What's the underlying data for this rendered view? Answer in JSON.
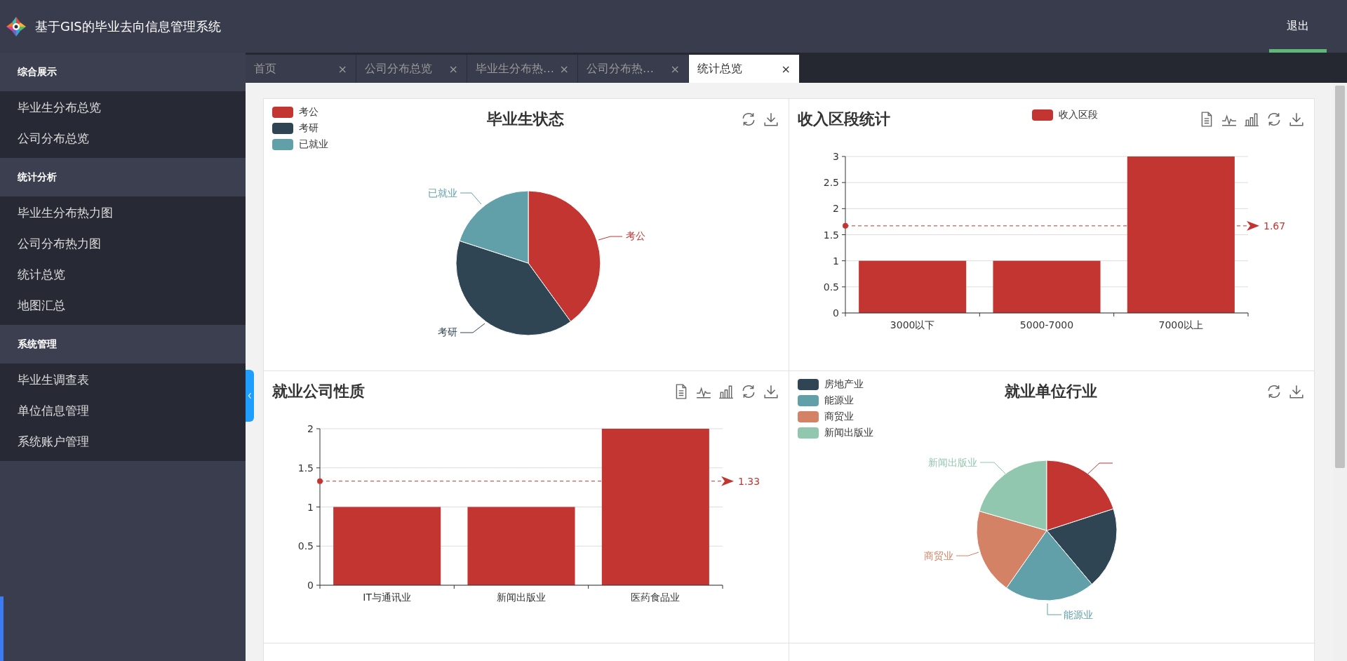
{
  "app": {
    "title": "基于GIS的毕业去向信息管理系统",
    "logout": "退出"
  },
  "sidebar": {
    "sections": [
      {
        "heading": "综合展示",
        "items": [
          {
            "label": "毕业生分布总览",
            "selected": false
          },
          {
            "label": "公司分布总览",
            "selected": false
          }
        ]
      },
      {
        "heading": "统计分析",
        "items": [
          {
            "label": "毕业生分布热力图",
            "selected": false
          },
          {
            "label": "公司分布热力图",
            "selected": false
          },
          {
            "label": "统计总览",
            "selected": false
          },
          {
            "label": "地图汇总",
            "selected": false
          }
        ]
      },
      {
        "heading": "系统管理",
        "items": [
          {
            "label": "毕业生调查表",
            "selected": false
          },
          {
            "label": "单位信息管理",
            "selected": false
          },
          {
            "label": "系统账户管理",
            "selected": false
          }
        ]
      }
    ]
  },
  "tabs": [
    {
      "label": "首页",
      "close": "×",
      "selected": false
    },
    {
      "label": "公司分布总览",
      "close": "×",
      "selected": false
    },
    {
      "label": "毕业生分布热…",
      "close": "×",
      "selected": false
    },
    {
      "label": "公司分布热…",
      "close": "×",
      "selected": false
    },
    {
      "label": "统计总览",
      "close": "×",
      "selected": true
    }
  ],
  "cards": [
    {
      "kind": "pie",
      "title": "毕业生状态",
      "legend": [
        {
          "label": "考公",
          "color": "#c23531"
        },
        {
          "label": "考研",
          "color": "#2f4554"
        },
        {
          "label": "已就业",
          "color": "#61a0a8"
        }
      ],
      "slice_labels": [
        "考公",
        "考研",
        "已就业"
      ]
    },
    {
      "kind": "bar",
      "chart_data": {
        "type": "bar",
        "title": "收入区段统计",
        "categories": [
          "3000以下",
          "5000-7000",
          "7000以上"
        ],
        "series": [
          {
            "name": "收入区段",
            "color": "#c23531",
            "values": [
              1,
              1,
              3
            ]
          }
        ],
        "ylim": [
          0,
          3
        ],
        "yticks": [
          0,
          0.5,
          1,
          1.5,
          2,
          2.5,
          3
        ],
        "grid": true,
        "ref_lines": [
          {
            "axis": "y",
            "value": 1.67,
            "label": "1.67"
          }
        ]
      }
    },
    {
      "kind": "bar",
      "chart_data": {
        "type": "bar",
        "title": "就业公司性质",
        "categories": [
          "IT与通讯业",
          "新闻出版业",
          "医药食品业"
        ],
        "series": [
          {
            "color": "#c23531",
            "values": [
              1,
              1,
              2
            ]
          }
        ],
        "ylim": [
          0,
          2
        ],
        "yticks": [
          0,
          0.5,
          1,
          1.5,
          2
        ],
        "grid": true,
        "ref_lines": [
          {
            "axis": "y",
            "value": 1.33,
            "label": "1.33"
          }
        ]
      }
    },
    {
      "kind": "pie",
      "title": "就业单位行业",
      "legend": [
        {
          "label": "房地产业",
          "color": "#2f4554"
        },
        {
          "label": "能源业",
          "color": "#61a0a8"
        },
        {
          "label": "商贸业",
          "color": "#d48265"
        },
        {
          "label": "新闻出版业",
          "color": "#91c7ae"
        }
      ],
      "slice_labels": [
        "新闻出版业",
        "商贸业",
        "能源业"
      ]
    },
    {
      "kind": "empty"
    },
    {
      "kind": "empty"
    }
  ]
}
